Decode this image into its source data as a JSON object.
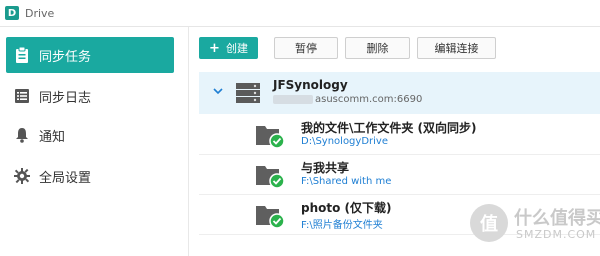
{
  "app": {
    "title": "Drive",
    "logo_letter": "D"
  },
  "sidebar": {
    "items": [
      {
        "label": "同步任务",
        "icon": "clipboard-icon",
        "active": true
      },
      {
        "label": "同步日志",
        "icon": "log-list-icon",
        "active": false
      },
      {
        "label": "通知",
        "icon": "bell-icon",
        "active": false
      },
      {
        "label": "全局设置",
        "icon": "gear-icon",
        "active": false
      }
    ]
  },
  "toolbar": {
    "create_label": "创建",
    "pause_label": "暂停",
    "delete_label": "删除",
    "edit_connection_label": "编辑连接"
  },
  "connection": {
    "name": "JFSynology",
    "address": "asuscomm.com:6690"
  },
  "tasks": [
    {
      "name": "我的文件\\工作文件夹 (双向同步)",
      "path": "D:\\SynologyDrive"
    },
    {
      "name": "与我共享",
      "path": "F:\\Shared with me"
    },
    {
      "name": "photo (仅下载)",
      "path": "F:\\照片备份文件夹"
    }
  ],
  "watermark": {
    "mark": "值",
    "text": "什么值得买",
    "sub": "SMZDM.COM"
  },
  "colors": {
    "accent": "#1aa9a0",
    "selected_row": "#e7f4fb",
    "path_link": "#1f7fd3",
    "status_ok": "#2bb24c"
  }
}
